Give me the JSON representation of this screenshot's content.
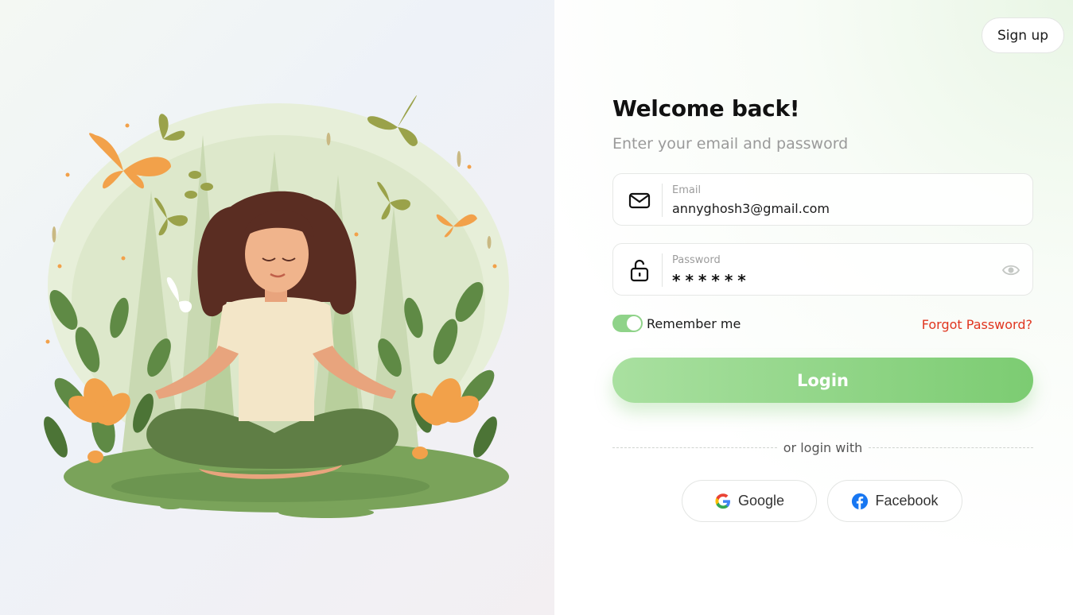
{
  "header": {
    "signup_label": "Sign up"
  },
  "form": {
    "title": "Welcome back!",
    "subtitle": "Enter your email and password",
    "email": {
      "label": "Email",
      "value": "annyghosh3@gmail.com"
    },
    "password": {
      "label": "Password",
      "masked_value": "******"
    },
    "remember_label": "Remember me",
    "remember_checked": true,
    "forgot_label": "Forgot Password?",
    "login_label": "Login",
    "divider_text": "or login with",
    "social": {
      "google_label": "Google",
      "facebook_label": "Facebook"
    }
  },
  "colors": {
    "accent_green": "#8fd389",
    "login_gradient_start": "#a9e0a0",
    "login_gradient_end": "#7ccc72",
    "forgot_red": "#e0351f",
    "facebook_blue": "#1877f2"
  },
  "icons": [
    "envelope-icon",
    "lock-open-icon",
    "eye-icon",
    "google-icon",
    "facebook-icon"
  ]
}
